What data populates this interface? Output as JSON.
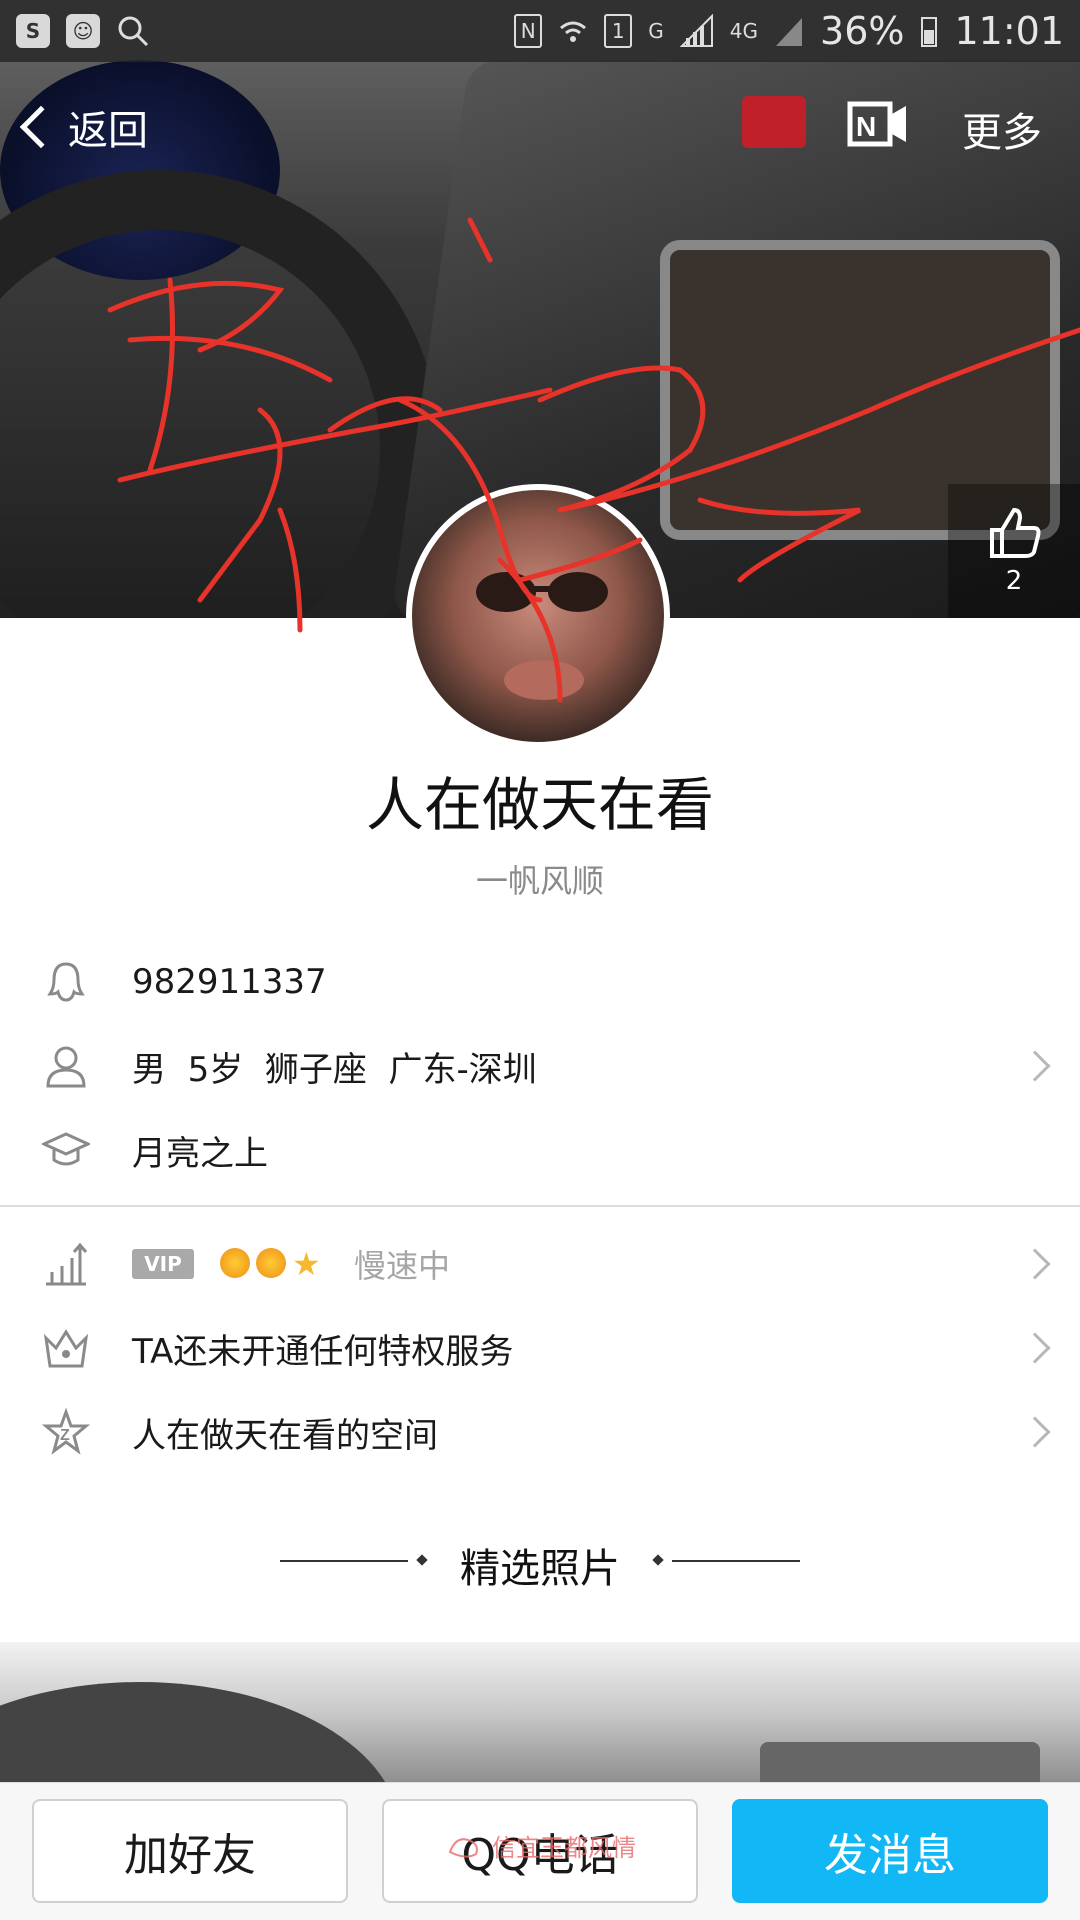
{
  "status_bar": {
    "left_icons": [
      "s-app-icon",
      "baidu-icon",
      "search-icon"
    ],
    "nfc": "N",
    "sim": "1",
    "network_g": "G",
    "network_4g": "4G",
    "battery": "36%",
    "time": "11:01"
  },
  "nav": {
    "back_label": "返回",
    "more_label": "更多"
  },
  "likes": {
    "count": "2"
  },
  "profile": {
    "nickname": "人在做天在看",
    "signature": "一帆风顺"
  },
  "info": {
    "qq_number": "982911337",
    "personal": "男  5岁  狮子座  广东-深圳",
    "school": "月亮之上"
  },
  "level": {
    "vip_badge": "VIP",
    "speed_text": "慢速中"
  },
  "privilege": {
    "text": "TA还未开通任何特权服务"
  },
  "space": {
    "text": "人在做天在看的空间"
  },
  "photos": {
    "section_title": "精选照片"
  },
  "actions": {
    "add_friend": "加好友",
    "qq_call": "QQ电话",
    "send_message": "发消息"
  },
  "watermark": {
    "text": "信宜玉都风情"
  },
  "colors": {
    "primary_blue": "#12b7f5",
    "scribble_red": "#e8332a",
    "divider": "#dcdcdc"
  }
}
